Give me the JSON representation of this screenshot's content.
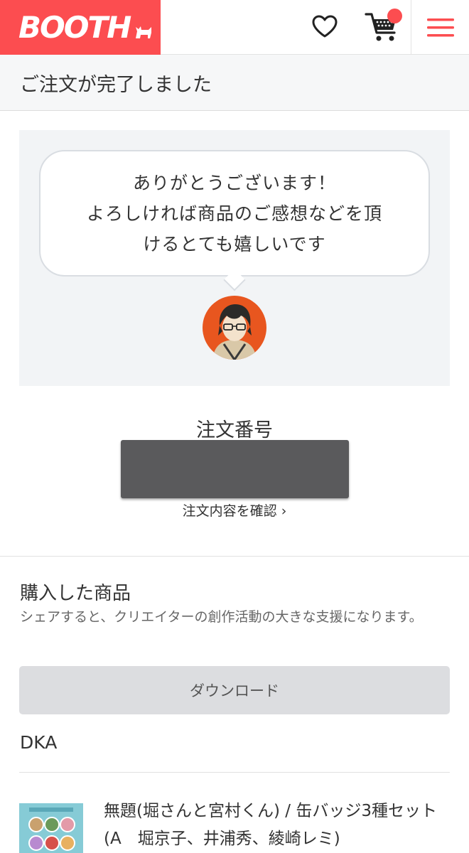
{
  "header": {
    "logo_text": "BOOTH",
    "brand_color": "#fc4d50",
    "icons": [
      "heart-icon",
      "cart-icon",
      "menu-icon"
    ]
  },
  "titlebar": {
    "title": "ご注文が完了しました"
  },
  "thanks": {
    "lines": [
      "ありがとうございます！",
      "よろしければ商品のご感想などを頂",
      "けるとても嬉しいです"
    ]
  },
  "order": {
    "label": "注文番号",
    "link_label": "注文内容を確認 ›"
  },
  "purchased": {
    "title": "購入した商品",
    "description": "シェアすると、クリエイターの創作活動の大きな支援になります。",
    "download_label": "ダウンロード",
    "shop_name": "DKA",
    "item_name": "無題(堀さんと宮村くん) / 缶バッジ3種セット (A　堀京子、井浦秀、綾崎レミ)"
  }
}
